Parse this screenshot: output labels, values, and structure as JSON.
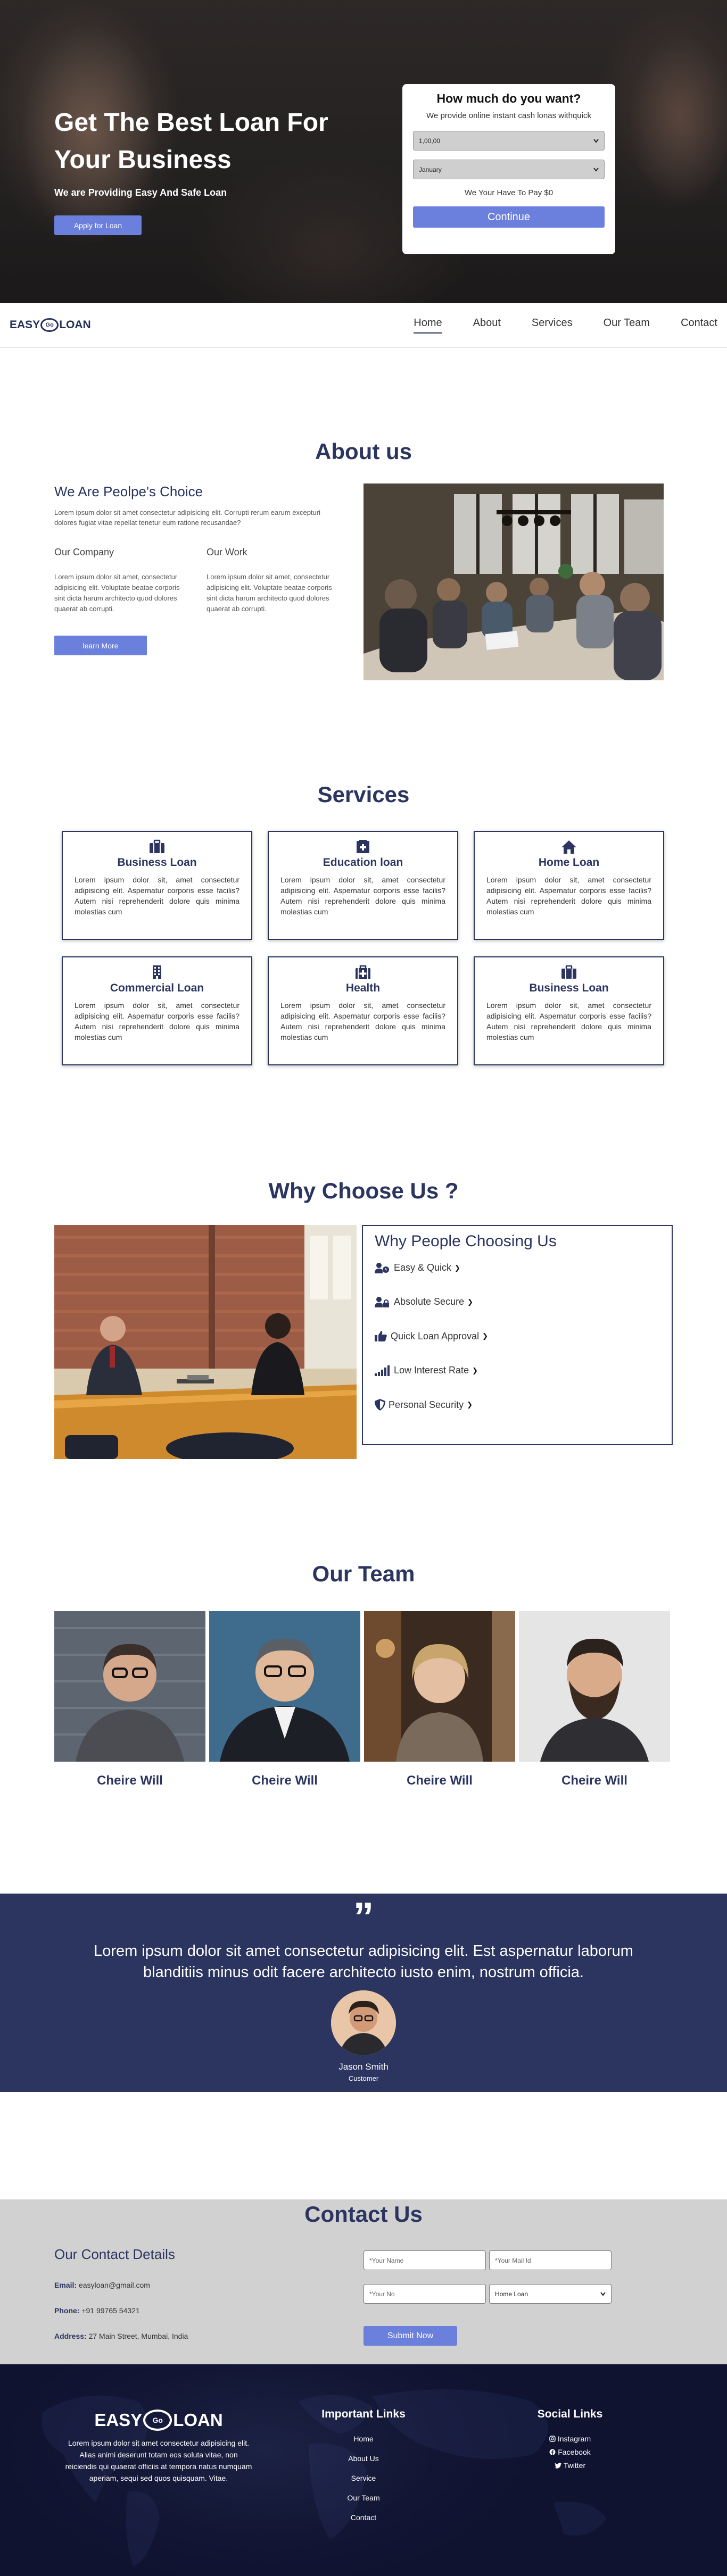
{
  "hero": {
    "title": "Get The Best Loan For Your Business",
    "subtitle": "We are Providing Easy And Safe Loan",
    "cta_label": "Apply for Loan",
    "card": {
      "heading": "How much do you want?",
      "description": "We provide online instant cash lonas withquick",
      "amount_selected": "1,00,00",
      "month_selected": "January",
      "pay_text": "We Your Have To Pay $0",
      "continue_label": "Continue"
    }
  },
  "nav": {
    "logo_left": "EASY",
    "logo_mark": "Go",
    "logo_right": "LOAN",
    "links": [
      "Home",
      "About",
      "Services",
      "Our Team",
      "Contact"
    ],
    "active": "Home"
  },
  "about": {
    "title": "About us",
    "heading": "We Are Peolpe's Choice",
    "text": "Lorem ipsum dolor sit amet consectetur adipisicing elit. Corrupti rerum earum excepturi dolores fugiat vitae repellat tenetur eum ratione recusandae?",
    "col1_title": "Our Company",
    "col1_text": "Lorem ipsum dolor sit amet, consectetur adipisicing elit. Voluptate beatae corporis sint dicta harum architecto quod dolores quaerat ab corrupti.",
    "col2_title": "Our Work",
    "col2_text": "Lorem ipsum dolor sit amet, consectetur adipisicing elit. Voluptate beatae corporis sint dicta harum architecto quod dolores quaerat ab corrupti.",
    "button_label": "learn More"
  },
  "services": {
    "title": "Services",
    "items": [
      {
        "title": "Business Loan",
        "icon": "briefcase-icon",
        "text": "Lorem ipsum dolor sit, amet consectetur adipisicing elit. Aspernatur corporis esse facilis? Autem nisi reprehenderit dolore quis minima molestias cum"
      },
      {
        "title": "Education loan",
        "icon": "graduation-cap-icon",
        "text": "Lorem ipsum dolor sit, amet consectetur adipisicing elit. Aspernatur corporis esse facilis? Autem nisi reprehenderit dolore quis minima molestias cum"
      },
      {
        "title": "Home Loan",
        "icon": "home-icon",
        "text": "Lorem ipsum dolor sit, amet consectetur adipisicing elit. Aspernatur corporis esse facilis? Autem nisi reprehenderit dolore quis minima molestias cum"
      },
      {
        "title": "Commercial Loan",
        "icon": "building-icon",
        "text": "Lorem ipsum dolor sit, amet consectetur adipisicing elit. Aspernatur corporis esse facilis? Autem nisi reprehenderit dolore quis minima molestias cum"
      },
      {
        "title": "Health",
        "icon": "medkit-icon",
        "text": "Lorem ipsum dolor sit, amet consectetur adipisicing elit. Aspernatur corporis esse facilis? Autem nisi reprehenderit dolore quis minima molestias cum"
      },
      {
        "title": "Business Loan",
        "icon": "briefcase-icon",
        "text": "Lorem ipsum dolor sit, amet consectetur adipisicing elit. Aspernatur corporis esse facilis? Autem nisi reprehenderit dolore quis minima molestias cum"
      }
    ]
  },
  "why": {
    "title": "Why Choose Us ?",
    "heading": "Why People Choosing Us",
    "items": [
      {
        "label": "Easy & Quick",
        "icon": "user-clock-icon"
      },
      {
        "label": "Absolute Secure",
        "icon": "user-lock-icon"
      },
      {
        "label": "Quick Loan Approval",
        "icon": "thumbs-up-icon"
      },
      {
        "label": "Low Interest Rate",
        "icon": "signal-icon"
      },
      {
        "label": "Personal Security",
        "icon": "shield-icon"
      }
    ]
  },
  "team": {
    "title": "Our Team",
    "members": [
      {
        "name": "Cheire Will"
      },
      {
        "name": "Cheire Will"
      },
      {
        "name": "Cheire Will"
      },
      {
        "name": "Cheire Will"
      }
    ]
  },
  "testimonial": {
    "quote": "Lorem ipsum dolor sit amet consectetur adipisicing elit. Est aspernatur laborum blanditiis minus odit facere architecto iusto enim, nostrum officia.",
    "name": "Jason Smith",
    "role": "Customer"
  },
  "contact": {
    "title": "Contact Us",
    "details_heading": "Our Contact Details",
    "email_label": "Email:",
    "email": "easyloan@gmail.com",
    "phone_label": "Phone:",
    "phone": "+91 99765 54321",
    "address_label": "Address:",
    "address": "27 Main Street, Mumbai, India",
    "name_placeholder": "*Your Name",
    "mail_placeholder": "*Your Mail Id",
    "no_placeholder": "*Your No",
    "loan_select": "Home Loan",
    "submit_label": "Submit Now"
  },
  "footer": {
    "logo_left": "EASY",
    "logo_mark": "Go",
    "logo_right": "LOAN",
    "description": "Lorem ipsum dolor sit amet consectetur adipisicing elit. Alias animi deserunt totam eos soluta vitae, non reiciendis qui quaerat officiis at tempora natus numquam aperiam, sequi sed quos quisquam. Vitae.",
    "links_heading": "Important Links",
    "links": [
      "Home",
      "About Us",
      "Service",
      "Our Team",
      "Contact"
    ],
    "social_heading": "Social Links",
    "social": [
      {
        "label": "Instagram",
        "icon": "instagram-icon"
      },
      {
        "label": "Facebook",
        "icon": "facebook-icon"
      },
      {
        "label": "Twitter",
        "icon": "twitter-icon"
      }
    ]
  },
  "colors": {
    "brand_navy": "#2b3560",
    "accent_blue": "#6b7fdd"
  }
}
